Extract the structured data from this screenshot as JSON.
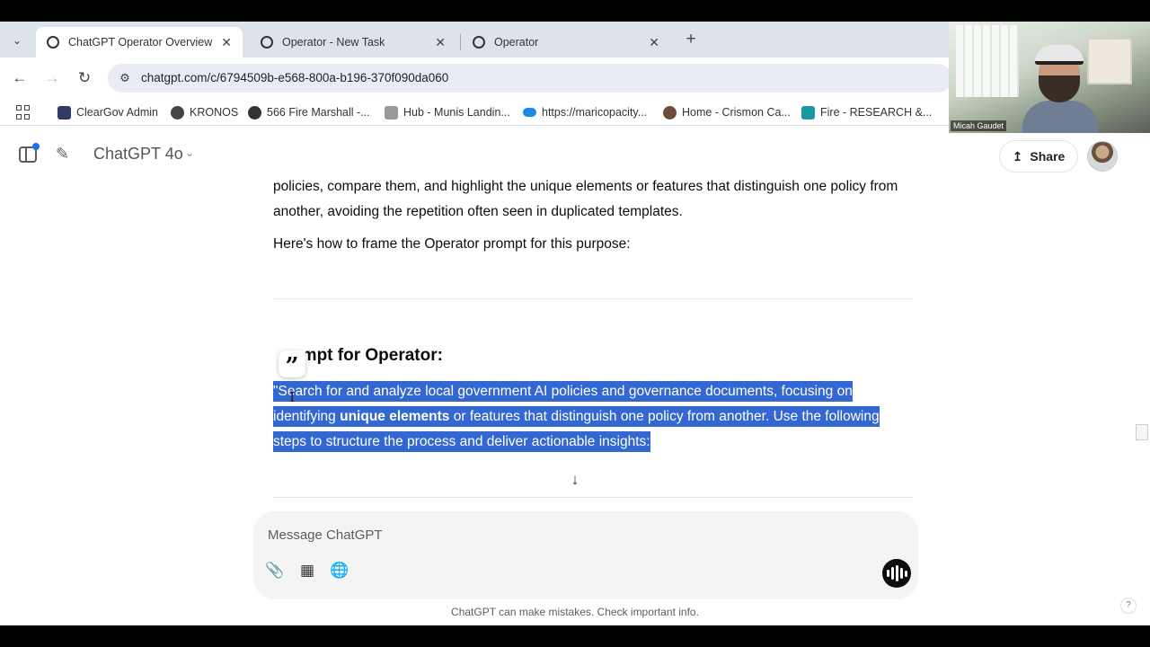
{
  "browser": {
    "tabs": [
      {
        "title": "ChatGPT Operator Overview",
        "active": true
      },
      {
        "title": "Operator - New Task",
        "active": false
      },
      {
        "title": "Operator",
        "active": false
      }
    ],
    "url": "chatgpt.com/c/6794509b-e568-800a-b196-370f090da060",
    "bookmarks": [
      {
        "label": "ClearGov Admin",
        "color": "#2f3b63"
      },
      {
        "label": "KRONOS",
        "color": "#444444"
      },
      {
        "label": "566 Fire Marshall -...",
        "color": "#333333"
      },
      {
        "label": "Hub - Munis Landin...",
        "color": "#8a8a8a"
      },
      {
        "label": "https://maricopacity...",
        "color": "#1e88e5"
      },
      {
        "label": "Home - Crismon Ca...",
        "color": "#6b4d3a"
      },
      {
        "label": "Fire - RESEARCH &...",
        "color": "#1a9aa0"
      }
    ]
  },
  "webcam": {
    "name": "Micah Gaudet"
  },
  "app": {
    "model": "ChatGPT 4o",
    "share_label": "Share"
  },
  "chat": {
    "para1": "policies, compare them, and highlight the unique elements or features that distinguish one policy from another, avoiding the repetition often seen in duplicated templates.",
    "para2": "Here's how to frame the Operator prompt for this purpose:",
    "heading": "Prompt for Operator:",
    "quote_glyph": "”",
    "selected_part1": "\"Search for and analyze local government AI policies and governance documents, focusing on identifying ",
    "selected_bold": "unique elements",
    "selected_part2": " or features that distinguish one policy from another. Use the following steps to structure the process and deliver actionable insights:"
  },
  "composer": {
    "placeholder": "Message ChatGPT"
  },
  "footer": {
    "disclaimer": "ChatGPT can make mistakes. Check important info.",
    "help": "?"
  },
  "colors": {
    "selection": "#3367d1",
    "tab_strip": "#dee3eb"
  }
}
